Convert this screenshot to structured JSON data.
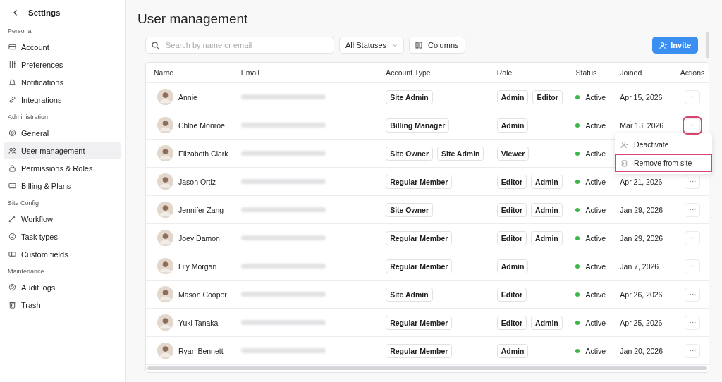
{
  "sidebar": {
    "title": "Settings",
    "sections": [
      {
        "heading": "Personal",
        "items": [
          {
            "label": "Account",
            "selected": false
          },
          {
            "label": "Preferences",
            "selected": false
          },
          {
            "label": "Notifications",
            "selected": false
          },
          {
            "label": "Integrations",
            "selected": false
          }
        ]
      },
      {
        "heading": "Administration",
        "items": [
          {
            "label": "General",
            "selected": false
          },
          {
            "label": "User management",
            "selected": true
          },
          {
            "label": "Permissions & Roles",
            "selected": false
          },
          {
            "label": "Billing & Plans",
            "selected": false
          }
        ]
      },
      {
        "heading": "Site Config",
        "items": [
          {
            "label": "Workflow",
            "selected": false
          },
          {
            "label": "Task types",
            "selected": false
          },
          {
            "label": "Custom fields",
            "selected": false
          }
        ]
      },
      {
        "heading": "Maintenance",
        "items": [
          {
            "label": "Audit logs",
            "selected": false
          },
          {
            "label": "Trash",
            "selected": false
          }
        ]
      }
    ]
  },
  "page": {
    "title": "User management"
  },
  "toolbar": {
    "search": {
      "placeholder": "Search by name or email"
    },
    "status_filter": "All Statuses",
    "columns_button": "Columns",
    "invite_button": "Invite"
  },
  "table": {
    "columns": [
      "Name",
      "Email",
      "Account Type",
      "Role",
      "Status",
      "Joined",
      "Actions"
    ],
    "rows": [
      {
        "name": "Annie",
        "account_types": [
          "Site Admin"
        ],
        "roles": [
          "Admin",
          "Editor"
        ],
        "status": "Active",
        "joined": "Apr 15, 2026",
        "highlighted": false
      },
      {
        "name": "Chloe Monroe",
        "account_types": [
          "Billing Manager"
        ],
        "roles": [
          "Admin"
        ],
        "status": "Active",
        "joined": "Mar 13, 2026",
        "highlighted": true
      },
      {
        "name": "Elizabeth Clark",
        "account_types": [
          "Site Owner",
          "Site Admin"
        ],
        "roles": [
          "Viewer"
        ],
        "status": "Active",
        "highlighted": false
      },
      {
        "name": "Jason Ortiz",
        "account_types": [
          "Regular Member"
        ],
        "roles": [
          "Editor",
          "Admin"
        ],
        "status": "Active",
        "joined": "Apr 21, 2026",
        "highlighted": false
      },
      {
        "name": "Jennifer Zang",
        "account_types": [
          "Site Owner"
        ],
        "roles": [
          "Editor",
          "Admin"
        ],
        "status": "Active",
        "joined": "Jan 29, 2026",
        "highlighted": false
      },
      {
        "name": "Joey Damon",
        "account_types": [
          "Regular Member"
        ],
        "roles": [
          "Editor",
          "Admin"
        ],
        "status": "Active",
        "joined": "Jan 29, 2026",
        "highlighted": false
      },
      {
        "name": "Lily Morgan",
        "account_types": [
          "Regular Member"
        ],
        "roles": [
          "Admin"
        ],
        "status": "Active",
        "joined": "Jan 7, 2026",
        "highlighted": false
      },
      {
        "name": "Mason Cooper",
        "account_types": [
          "Site Admin"
        ],
        "roles": [
          "Editor"
        ],
        "status": "Active",
        "joined": "Apr 26, 2026",
        "highlighted": false
      },
      {
        "name": "Yuki Tanaka",
        "account_types": [
          "Regular Member"
        ],
        "roles": [
          "Editor",
          "Admin"
        ],
        "status": "Active",
        "joined": "Apr 25, 2026",
        "highlighted": false
      },
      {
        "name": "Ryan Bennett",
        "account_types": [
          "Regular Member"
        ],
        "roles": [
          "Admin"
        ],
        "status": "Active",
        "joined": "Jan 20, 2026",
        "highlighted": false
      }
    ]
  },
  "actions_menu": {
    "items": [
      {
        "label": "Deactivate",
        "highlighted": false
      },
      {
        "label": "Remove from site",
        "highlighted": true
      }
    ]
  }
}
